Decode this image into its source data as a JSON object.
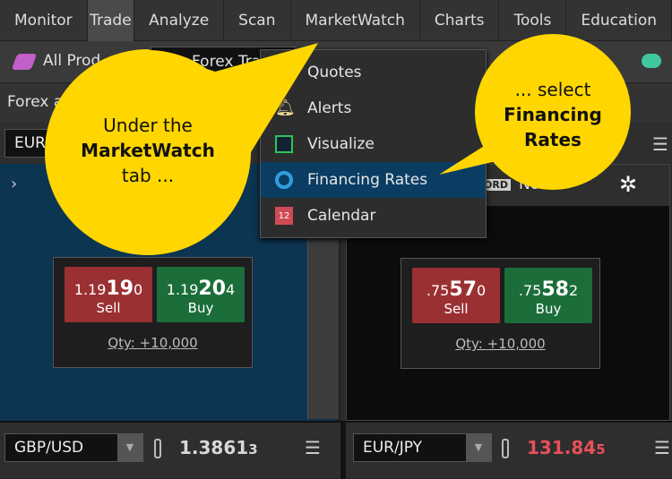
{
  "nav": {
    "tabs": [
      "Monitor",
      "Trade",
      "Analyze",
      "Scan",
      "MarketWatch",
      "Charts",
      "Tools",
      "Education"
    ],
    "active": "Trade"
  },
  "toolbar": {
    "products": "All Prod",
    "page_select": "Forex Tra"
  },
  "section_title": "Forex a",
  "top_symbol": "EUR",
  "menu": {
    "items": [
      {
        "label": "Quotes",
        "icon": "quotes-icon"
      },
      {
        "label": "Alerts",
        "icon": "bell-icon"
      },
      {
        "label": "Visualize",
        "icon": "chart-icon"
      },
      {
        "label": "Financing Rates",
        "icon": "financing-icon",
        "selected": true
      },
      {
        "label": "Calendar",
        "icon": "calendar-icon"
      }
    ]
  },
  "right_header": {
    "badge": "ORD",
    "value": "None"
  },
  "quotes": [
    {
      "sell_prefix": "1.19",
      "sell_big": "19",
      "sell_suffix": "0",
      "buy_prefix": "1.19",
      "buy_big": "20",
      "buy_suffix": "4",
      "sell": "Sell",
      "buy": "Buy",
      "qty": "Qty: +10,000"
    },
    {
      "sell_prefix": ".75",
      "sell_big": "57",
      "sell_suffix": "0",
      "buy_prefix": ".75",
      "buy_big": "58",
      "buy_suffix": "2",
      "sell": "Sell",
      "buy": "Buy",
      "qty": "Qty: +10,000"
    }
  ],
  "bottom": [
    {
      "symbol": "GBP/USD",
      "price": "1.3861",
      "price_last": "3",
      "color": "#d8d8d8"
    },
    {
      "symbol": "EUR/JPY",
      "price": "131.84",
      "price_last": "5",
      "color": "#e8505b"
    }
  ],
  "callouts": {
    "left": {
      "line1": "Under the",
      "bold": "MarketWatch",
      "line3": "tab ..."
    },
    "right": {
      "line1": "... select",
      "bold1": "Financing",
      "bold2": "Rates"
    },
    "color": "#ffd600"
  }
}
